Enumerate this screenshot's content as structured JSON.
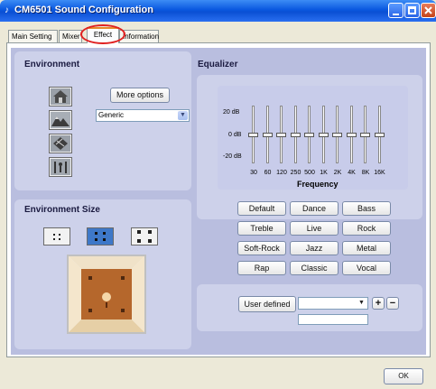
{
  "window": {
    "title": "CM6501 Sound Configuration",
    "accent": "#0a58e0"
  },
  "tabs": [
    {
      "label": "Main Setting"
    },
    {
      "label": "Mixer"
    },
    {
      "label": "Effect",
      "active": true
    },
    {
      "label": "Information"
    }
  ],
  "environment": {
    "title": "Environment",
    "more_options_label": "More options",
    "selected_preset": "Generic",
    "icon_buttons": [
      "house-icon",
      "mountains-icon",
      "sheet-icon",
      "arena-icon"
    ]
  },
  "environment_size": {
    "title": "Environment Size",
    "options": [
      "small",
      "medium",
      "large"
    ],
    "selected": "medium"
  },
  "equalizer": {
    "title": "Equalizer",
    "db_labels": [
      "20 dB",
      "0 dB",
      "-20 dB"
    ],
    "frequency_title": "Frequency",
    "bands": [
      "30",
      "60",
      "120",
      "250",
      "500",
      "1K",
      "2K",
      "4K",
      "8K",
      "16K"
    ],
    "band_gain_db": [
      0,
      0,
      0,
      0,
      0,
      0,
      0,
      0,
      0,
      0
    ],
    "presets": [
      "Default",
      "Dance",
      "Bass",
      "Treble",
      "Live",
      "Rock",
      "Soft-Rock",
      "Jazz",
      "Metal",
      "Rap",
      "Classic",
      "Vocal"
    ],
    "user_defined_label": "User defined",
    "user_defined_value": "",
    "user_defined_name": "",
    "add_label": "+",
    "remove_label": "−"
  },
  "footer": {
    "ok_label": "OK"
  }
}
